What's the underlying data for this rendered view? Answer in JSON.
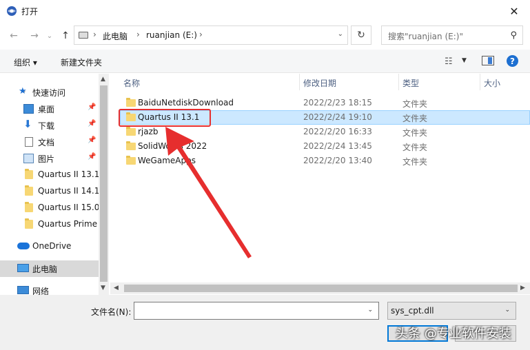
{
  "window": {
    "title": "打开"
  },
  "address": {
    "segments": [
      "此电脑",
      "ruanjian (E:)"
    ],
    "search_placeholder": "搜索\"ruanjian (E:)\""
  },
  "toolbar": {
    "organize": "组织",
    "new_folder": "新建文件夹"
  },
  "sidebar": {
    "quick_access": "快速访问",
    "items": [
      {
        "label": "桌面",
        "icon": "desktop-icon"
      },
      {
        "label": "下载",
        "icon": "download-icon"
      },
      {
        "label": "文档",
        "icon": "document-icon"
      },
      {
        "label": "图片",
        "icon": "picture-icon"
      },
      {
        "label": "Quartus II 13.1",
        "icon": "folder-icon"
      },
      {
        "label": "Quartus II 14.1",
        "icon": "folder-icon"
      },
      {
        "label": "Quartus II 15.0",
        "icon": "folder-icon"
      },
      {
        "label": "Quartus Prime",
        "icon": "folder-icon"
      }
    ],
    "onedrive": "OneDrive",
    "this_pc": "此电脑",
    "network": "网络"
  },
  "columns": {
    "name": "名称",
    "modified": "修改日期",
    "type": "类型",
    "size": "大小"
  },
  "files": [
    {
      "name": "BaiduNetdiskDownload",
      "modified": "2022/2/23 18:15",
      "type": "文件夹"
    },
    {
      "name": "Quartus II 13.1",
      "modified": "2022/2/24 19:10",
      "type": "文件夹"
    },
    {
      "name": "rjazb",
      "modified": "2022/2/20 16:33",
      "type": "文件夹"
    },
    {
      "name": "SolidWorks 2022",
      "modified": "2022/2/24 13:45",
      "type": "文件夹"
    },
    {
      "name": "WeGameApps",
      "modified": "2022/2/20 13:40",
      "type": "文件夹"
    }
  ],
  "bottom": {
    "filename_label": "文件名(N):",
    "filename_value": "",
    "filetype": "sys_cpt.dll"
  },
  "watermark": "头条 @专业软件安装",
  "colors": {
    "accent": "#0078d7",
    "selection": "#cce8ff",
    "annotation": "#e62e2e"
  }
}
